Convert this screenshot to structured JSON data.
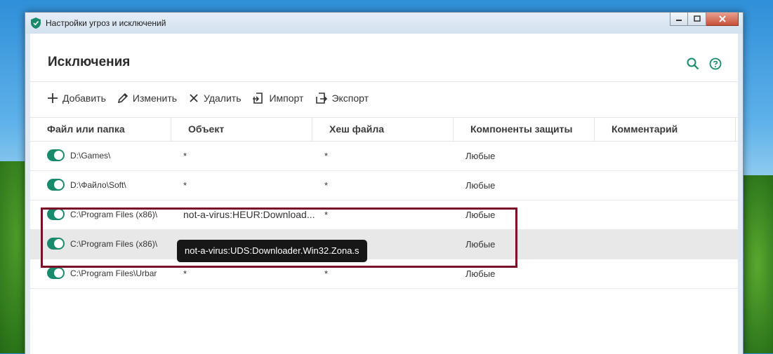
{
  "window": {
    "title": "Настройки угроз и исключений",
    "buttons": [
      "minimize",
      "maximize",
      "close"
    ]
  },
  "page": {
    "title": "Исключения",
    "search_icon": "search-icon",
    "help_icon": "help-icon"
  },
  "toolbar": {
    "add": "Добавить",
    "edit": "Изменить",
    "delete": "Удалить",
    "import": "Импорт",
    "export": "Экспорт"
  },
  "table": {
    "headers": [
      "Файл или папка",
      "Объект",
      "Хеш файла",
      "Компоненты защиты",
      "Комментарий"
    ],
    "rows": [
      {
        "enabled": true,
        "file": "D:\\Games\\",
        "object": "*",
        "hash": "*",
        "components": "Любые",
        "comment": ""
      },
      {
        "enabled": true,
        "file": "D:\\Файло\\Soft\\",
        "object": "*",
        "hash": "*",
        "components": "Любые",
        "comment": ""
      },
      {
        "enabled": true,
        "file": "C:\\Program Files (x86)\\",
        "object": "not-a-virus:HEUR:Download...",
        "hash": "*",
        "components": "Любые",
        "comment": ""
      },
      {
        "enabled": true,
        "file": "C:\\Program Files (x86)\\",
        "object": "",
        "hash": "",
        "components": "Любые",
        "comment": ""
      },
      {
        "enabled": true,
        "file": "C:\\Program Files\\Urbar",
        "object": "*",
        "hash": "*",
        "components": "Любые",
        "comment": ""
      }
    ]
  },
  "tooltip": {
    "text": "not-a-virus:UDS:Downloader.Win32.Zona.s"
  },
  "colors": {
    "accent": "#1a8a6c",
    "highlight_border": "#7a1028",
    "tooltip_bg": "#171717"
  }
}
